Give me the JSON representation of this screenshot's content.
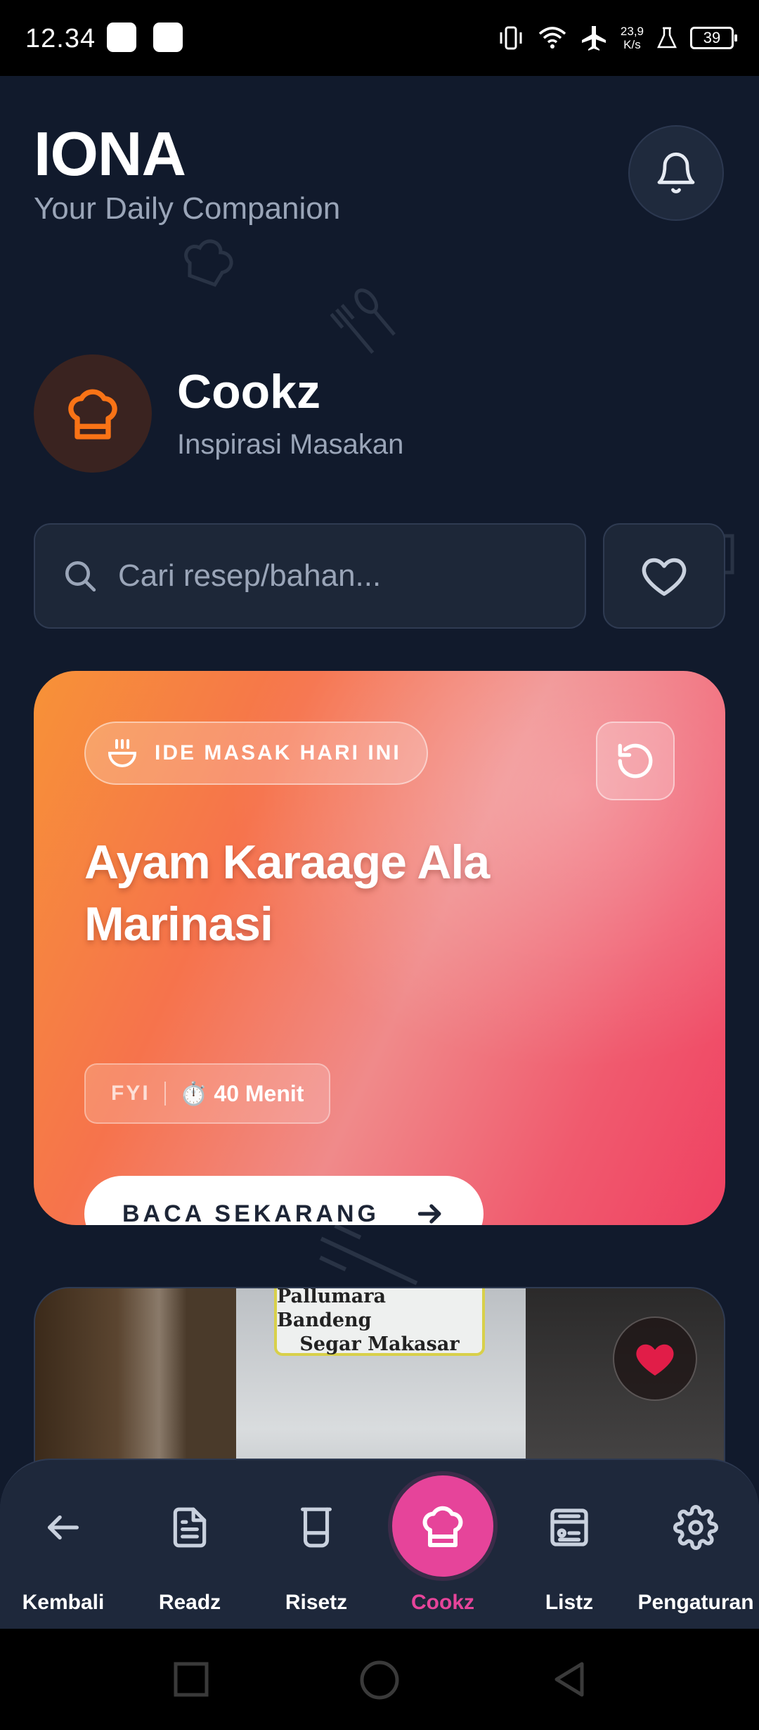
{
  "status_bar": {
    "time": "12.34",
    "speed_value": "23,9",
    "speed_unit": "K/s",
    "battery": "39"
  },
  "header": {
    "app_name": "IONA",
    "tagline": "Your Daily Companion",
    "notification_icon": "bell-icon"
  },
  "section": {
    "title": "Cookz",
    "subtitle": "Inspirasi Masakan",
    "icon": "chef-hat-icon",
    "accent": "#f97316"
  },
  "search": {
    "placeholder": "Cari resep/bahan...",
    "value": ""
  },
  "hero": {
    "chip_label": "IDE MASAK HARI INI",
    "title": "Ayam Karaage Ala Marinasi",
    "tag": "FYI",
    "duration": "⏱️ 40 Menit",
    "cta_label": "BACA SEKARANG",
    "gradient": [
      "#f79237",
      "#f08a8a",
      "#ef4162"
    ]
  },
  "recipe_card": {
    "image_caption_line1": "Pallumara Bandeng",
    "image_caption_line2": "Segar Makasar",
    "favorited": true,
    "heart_color": "#e11d48"
  },
  "nav": {
    "items": [
      {
        "label": "Kembali",
        "icon": "arrow-left-icon",
        "active": false
      },
      {
        "label": "Readz",
        "icon": "document-icon",
        "active": false
      },
      {
        "label": "Risetz",
        "icon": "beaker-icon",
        "active": false
      },
      {
        "label": "Cookz",
        "icon": "chef-hat-icon",
        "active": true
      },
      {
        "label": "Listz",
        "icon": "list-card-icon",
        "active": false
      },
      {
        "label": "Pengaturan",
        "icon": "gear-icon",
        "active": false
      }
    ],
    "active_color": "#e6449a"
  }
}
